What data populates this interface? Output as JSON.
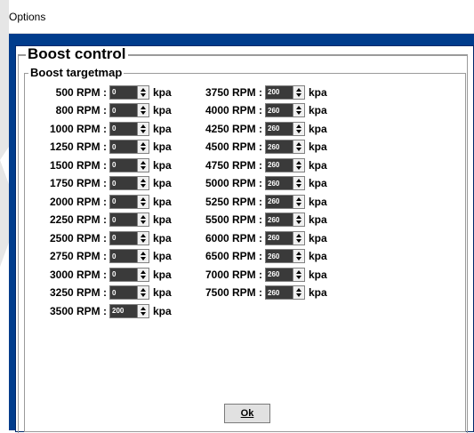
{
  "window": {
    "title": "Options"
  },
  "groups": {
    "outer_title": "Boost control",
    "inner_title": "Boost targetmap"
  },
  "unit": "kpa",
  "left_column": [
    {
      "rpm": "500 RPM :",
      "value": "0"
    },
    {
      "rpm": "800 RPM :",
      "value": "0"
    },
    {
      "rpm": "1000 RPM :",
      "value": "0"
    },
    {
      "rpm": "1250 RPM :",
      "value": "0"
    },
    {
      "rpm": "1500 RPM :",
      "value": "0"
    },
    {
      "rpm": "1750 RPM :",
      "value": "0"
    },
    {
      "rpm": "2000 RPM :",
      "value": "0"
    },
    {
      "rpm": "2250 RPM :",
      "value": "0"
    },
    {
      "rpm": "2500 RPM :",
      "value": "0"
    },
    {
      "rpm": "2750 RPM :",
      "value": "0"
    },
    {
      "rpm": "3000 RPM :",
      "value": "0"
    },
    {
      "rpm": "3250 RPM :",
      "value": "0"
    },
    {
      "rpm": "3500 RPM :",
      "value": "200"
    }
  ],
  "right_column": [
    {
      "rpm": "3750 RPM :",
      "value": "200"
    },
    {
      "rpm": "4000 RPM :",
      "value": "260"
    },
    {
      "rpm": "4250 RPM :",
      "value": "260"
    },
    {
      "rpm": "4500 RPM :",
      "value": "260"
    },
    {
      "rpm": "4750 RPM :",
      "value": "260"
    },
    {
      "rpm": "5000 RPM :",
      "value": "260"
    },
    {
      "rpm": "5250 RPM :",
      "value": "260"
    },
    {
      "rpm": "5500 RPM :",
      "value": "260"
    },
    {
      "rpm": "6000 RPM :",
      "value": "260"
    },
    {
      "rpm": "6500 RPM :",
      "value": "260"
    },
    {
      "rpm": "7000 RPM :",
      "value": "260"
    },
    {
      "rpm": "7500 RPM :",
      "value": "260"
    }
  ],
  "ok_button": {
    "label": "Ok"
  },
  "colors": {
    "window_frame": "#003c8c",
    "field_bg": "#3a3a3a",
    "field_text": "#ffffff"
  }
}
